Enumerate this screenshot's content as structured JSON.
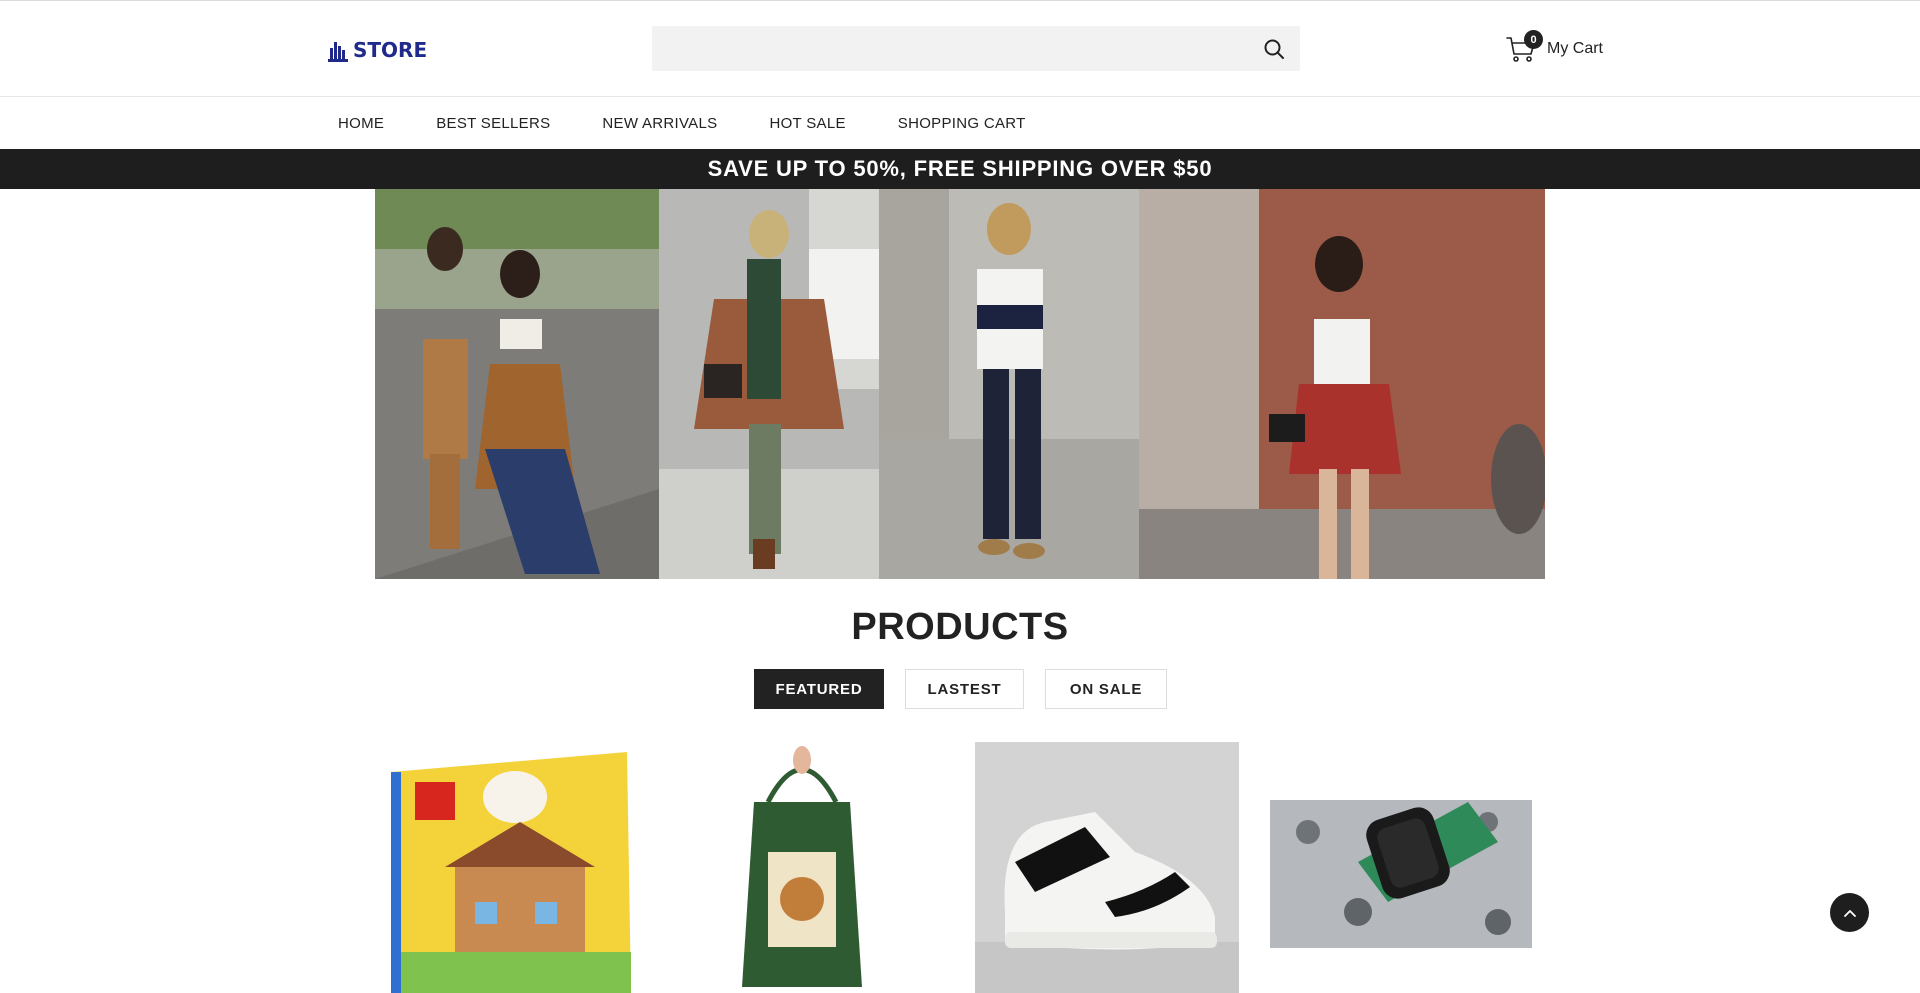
{
  "header": {
    "logo_text": "STORE",
    "search": {
      "value": "",
      "placeholder": ""
    },
    "cart": {
      "count": "0",
      "label": "My Cart"
    }
  },
  "nav": {
    "items": [
      "HOME",
      "BEST SELLERS",
      "NEW ARRIVALS",
      "HOT SALE",
      "SHOPPING CART"
    ]
  },
  "promo": {
    "text": "SAVE UP TO 50%, FREE SHIPPING OVER $50"
  },
  "products": {
    "title": "PRODUCTS",
    "tabs": [
      {
        "label": "FEATURED",
        "active": true
      },
      {
        "label": "LASTEST",
        "active": false
      },
      {
        "label": "ON SALE",
        "active": false
      }
    ],
    "items": [
      {
        "image": "lego-simpsons-house-box"
      },
      {
        "image": "green-tote-bag"
      },
      {
        "image": "high-top-sneaker"
      },
      {
        "image": "smartwatch-on-rocks"
      }
    ]
  },
  "colors": {
    "brand": "#1f2a8a",
    "dark": "#1e1e1e",
    "search_bg": "#f2f2f2"
  }
}
